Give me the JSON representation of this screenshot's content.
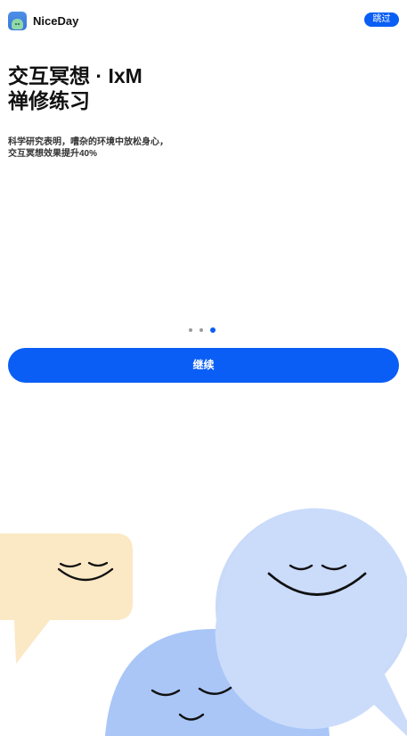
{
  "header": {
    "app_name": "NiceDay",
    "skip_label": "跳过"
  },
  "onboarding": {
    "title_line1": "交互冥想 · IxM",
    "title_line2": "禅修练习",
    "description_line1": "科学研究表明，嘈杂的环境中放松身心，",
    "description_line2": "交互冥想效果提升40%",
    "page_indicator": {
      "total": 3,
      "current": 3
    },
    "continue_label": "继续"
  },
  "colors": {
    "accent": "#0a5ef5",
    "bubble_yellow": "#fbe8c4",
    "bubble_light_blue": "#cbdcfb",
    "bubble_blue": "#a9c6f7"
  },
  "icons": {
    "app_icon": "niceday-app-icon",
    "illustration": "smiling-speech-bubbles-illustration"
  }
}
